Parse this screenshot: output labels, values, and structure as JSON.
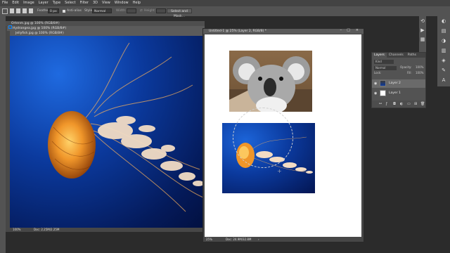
{
  "menu": [
    "File",
    "Edit",
    "Image",
    "Layer",
    "Type",
    "Select",
    "Filter",
    "3D",
    "View",
    "Window",
    "Help"
  ],
  "options": {
    "feather_label": "Feather:",
    "feather_value": "0 px",
    "antialias_label": "Anti-alias",
    "style_label": "Style:",
    "style_value": "Normal",
    "width_label": "Width:",
    "height_label": "Height:",
    "select_mask_label": "Select and Mask..."
  },
  "docs": {
    "tab1": "Ortenm.jpg @ 100% (RGB/8#)",
    "tab2": "Hydrangea.jpg @ 100% (RGB/8#)",
    "tab3": "Jellyfish.jpg @ 100% (RGB/8#)",
    "zoom_left": "100%",
    "doc_left": "Doc: 2.25M/2.25M",
    "untitled_title": "Untitled-1 @ 25% (Layer 2, RGB/8) *",
    "zoom_right": "25%",
    "doc_right": "Doc: 24.9M/32.8M"
  },
  "layers": {
    "tabs": [
      "Layers",
      "Channels",
      "Paths"
    ],
    "kind_label": "Kind",
    "blend_mode": "Normal",
    "opacity_label": "Opacity:",
    "opacity_value": "100%",
    "lock_label": "Lock:",
    "fill_label": "Fill:",
    "fill_value": "100%",
    "items": [
      {
        "name": "Layer 2"
      },
      {
        "name": "Layer 1"
      }
    ]
  },
  "colors": {
    "canvas_blue": "#0b3a9e",
    "app_bg": "#2b2b2b",
    "panel": "#535353"
  }
}
